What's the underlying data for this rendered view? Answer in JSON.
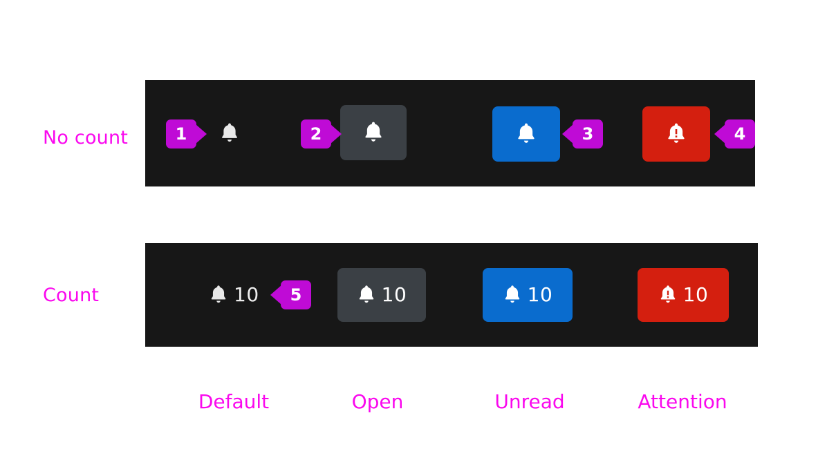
{
  "rows": [
    {
      "key": "no_count",
      "label": "No count"
    },
    {
      "key": "count",
      "label": "Count"
    }
  ],
  "columns": [
    {
      "key": "default",
      "caption": "Default"
    },
    {
      "key": "open",
      "caption": "Open"
    },
    {
      "key": "unread",
      "caption": "Unread"
    },
    {
      "key": "attention",
      "caption": "Attention"
    }
  ],
  "chips": {
    "no_count": {
      "default": {
        "icon": "bell-icon",
        "count": ""
      },
      "open": {
        "icon": "bell-icon",
        "count": ""
      },
      "unread": {
        "icon": "bell-icon",
        "count": ""
      },
      "attention": {
        "icon": "bell-alert-icon",
        "count": ""
      }
    },
    "count": {
      "default": {
        "icon": "bell-icon",
        "count": "10"
      },
      "open": {
        "icon": "bell-icon",
        "count": "10"
      },
      "unread": {
        "icon": "bell-icon",
        "count": "10"
      },
      "attention": {
        "icon": "bell-alert-icon",
        "count": "10"
      }
    }
  },
  "callouts": [
    {
      "id": "1",
      "number": "1",
      "direction": "right",
      "target": "no-count-default"
    },
    {
      "id": "2",
      "number": "2",
      "direction": "right",
      "target": "no-count-open"
    },
    {
      "id": "3",
      "number": "3",
      "direction": "left",
      "target": "no-count-unread"
    },
    {
      "id": "4",
      "number": "4",
      "direction": "left",
      "target": "no-count-attention"
    },
    {
      "id": "5",
      "number": "5",
      "direction": "left",
      "target": "count-default"
    }
  ],
  "colors": {
    "panel_background": "#171717",
    "page_background": "#ffffff",
    "annotation_magenta": "#fa08ee",
    "callout_purple": "#bf0bd6",
    "state_default_bell": "#e9e9e9",
    "state_open_background": "#3b4045",
    "state_unread_background": "#0a6cce",
    "state_attention_background": "#d41f0f",
    "on_solid_foreground": "#ffffff"
  }
}
